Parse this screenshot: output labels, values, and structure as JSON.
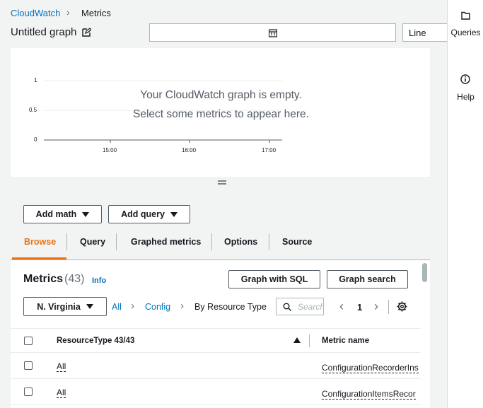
{
  "breadcrumb": {
    "root": "CloudWatch",
    "current": "Metrics"
  },
  "graph": {
    "title": "Untitled graph",
    "chart_type": "Line",
    "empty_line1": "Your CloudWatch graph is empty.",
    "empty_line2": "Select some metrics to appear here.",
    "y_ticks": [
      "1",
      "0.5",
      "0"
    ],
    "x_ticks": [
      "15:00",
      "16:00",
      "17:00"
    ]
  },
  "actions": {
    "add_math": "Add math",
    "add_query": "Add query"
  },
  "tabs": [
    "Browse",
    "Query",
    "Graphed metrics",
    "Options",
    "Source"
  ],
  "metrics": {
    "title": "Metrics",
    "count": "(43)",
    "info": "Info",
    "graph_sql": "Graph with SQL",
    "graph_search": "Graph search",
    "region": "N. Virginia",
    "path": {
      "all": "All",
      "namespace": "Config",
      "dimension": "By Resource Type"
    },
    "search_placeholder": "Search",
    "page": "1",
    "columns": {
      "resource": "ResourceType 43/43",
      "metric": "Metric name"
    },
    "rows": [
      {
        "resource": "All",
        "metric": "ConfigurationRecorderIns"
      },
      {
        "resource": "All",
        "metric": "ConfigurationItemsRecor"
      }
    ]
  },
  "rail": {
    "queries": "Queries",
    "help": "Help"
  },
  "colors": {
    "link": "#0073bb",
    "active_tab": "#ec7211",
    "background": "#f2f3f3"
  }
}
